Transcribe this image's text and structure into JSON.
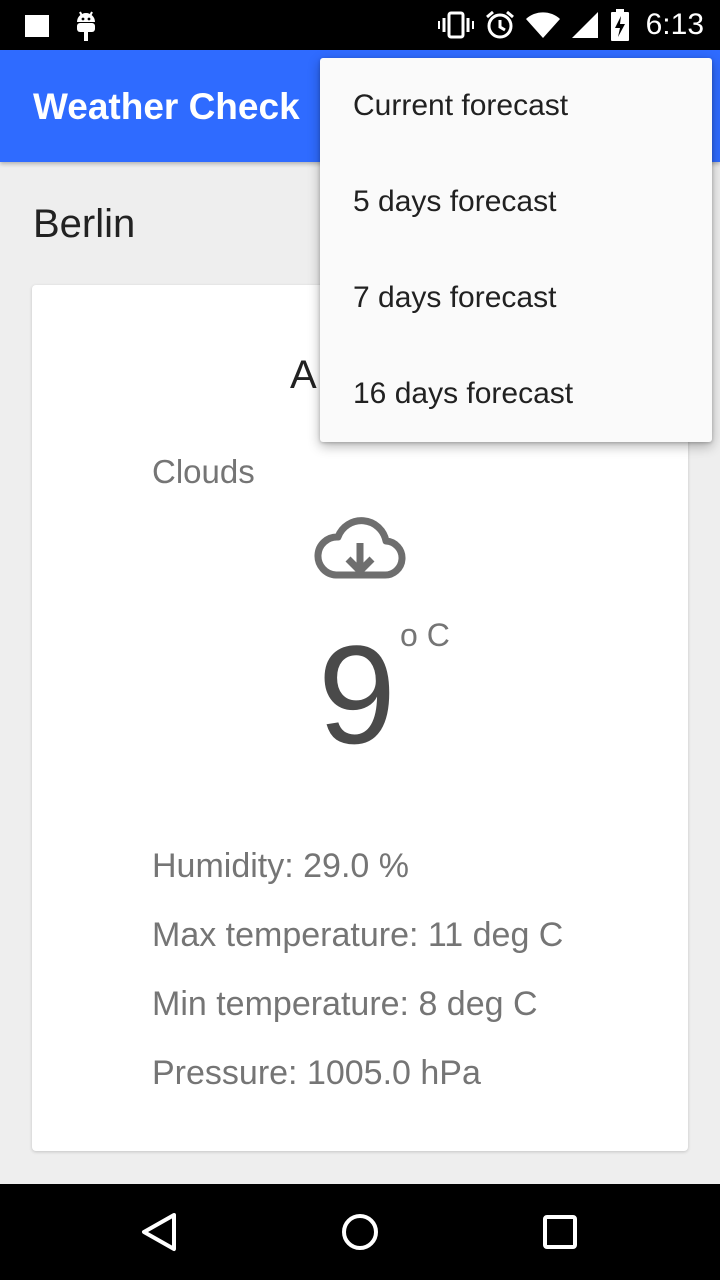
{
  "status_bar": {
    "time": "6:13",
    "icons": [
      "notification-square-icon",
      "android-icon",
      "vibrate-icon",
      "alarm-icon",
      "wifi-icon",
      "cell-signal-icon",
      "battery-charging-icon"
    ]
  },
  "app_bar": {
    "title": "Weather Check"
  },
  "city": "Berlin",
  "card": {
    "heading": "A",
    "condition": "Clouds",
    "icon": "cloud-download-icon",
    "temperature": "9",
    "temperature_unit": "o C",
    "humidity": "Humidity: 29.0 %",
    "max_temp": "Max temperature: 11 deg C",
    "min_temp": "Min temperature: 8 deg C",
    "pressure": "Pressure: 1005.0 hPa"
  },
  "menu": {
    "items": [
      {
        "label": "Current forecast"
      },
      {
        "label": "5 days forecast"
      },
      {
        "label": "7 days forecast"
      },
      {
        "label": "16 days forecast"
      }
    ]
  },
  "nav_bar": {
    "icons": [
      "back-icon",
      "home-icon",
      "recents-icon"
    ]
  },
  "colors": {
    "app_bar": "#2f6bff",
    "background": "#eeeeee",
    "card": "#ffffff",
    "menu": "#fafafa"
  }
}
